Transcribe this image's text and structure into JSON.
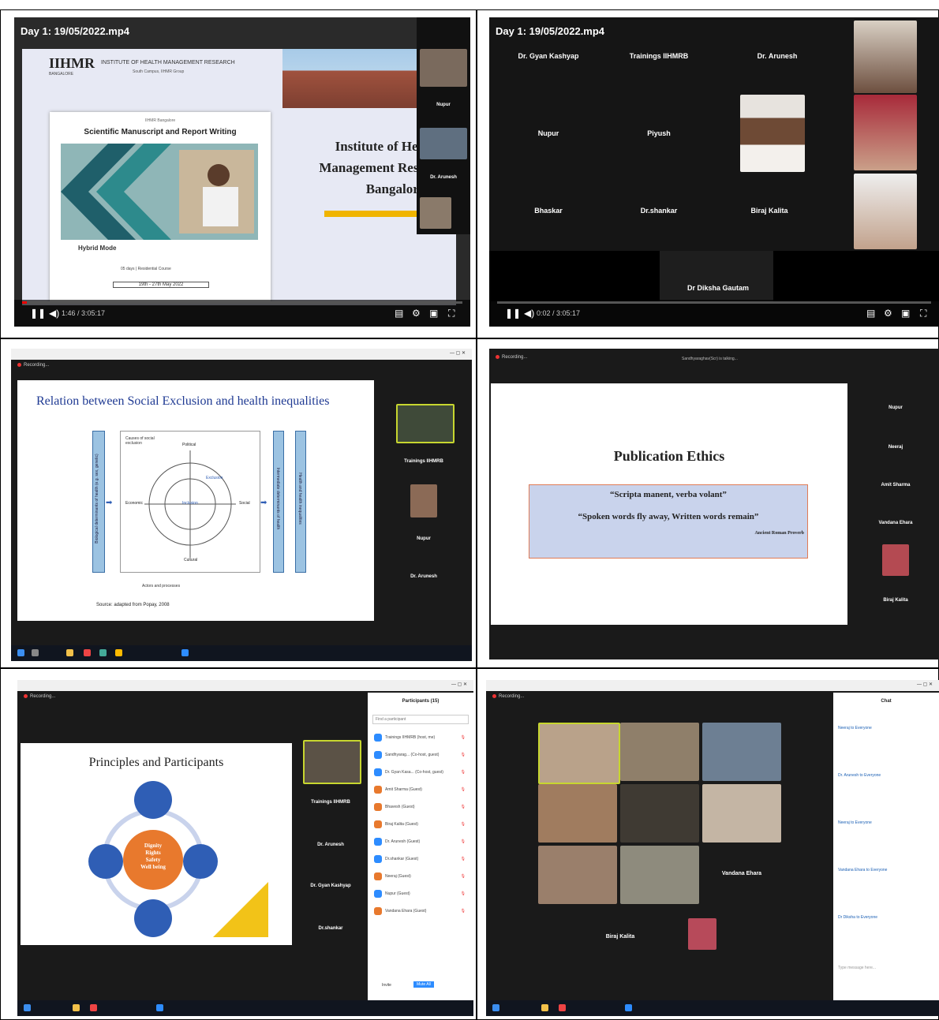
{
  "panels": {
    "p1": {
      "video_title": "Day 1: 19/05/2022.mp4",
      "logo_text": "IIHMR",
      "logo_subtext": "BANGALORE",
      "org_header": "INSTITUTE OF HEALTH MANAGEMENT RESEARCH",
      "org_sub": "South Campus, IIHMR Group",
      "poster_kicker": "IIHMR Bangalore",
      "poster_title": "Scientific Manuscript and Report Writing",
      "poster_mode": "Hybrid Mode",
      "poster_footer": "05 days | Residential Course",
      "poster_dates": "19th - 27th May 2022",
      "campus_line1": "Institute of Hea",
      "campus_line2": "Management Rese",
      "campus_line3": "Bangalore",
      "timecode": "1:46 / 3:05:17",
      "progress": 0.01,
      "side_tiles": [
        "Nupur",
        "Dr. Arunesh"
      ]
    },
    "p2": {
      "video_title": "Day 1: 19/05/2022.mp4",
      "timecode": "0:02 / 3:05:17",
      "progress": 0.0,
      "tiles": [
        "Dr. Gyan Kashyap",
        "Trainings IIHMRB",
        "Dr. Arunesh",
        "Nupur",
        "Piyush",
        "Bhaskar",
        "Dr.shankar",
        "Biraj Kalita",
        "Dr Diksha Gautam"
      ]
    },
    "p3": {
      "recording": "Recording...",
      "slide_title": "Relation between Social Exclusion and health inequalities",
      "left_bar": "Biological determinants of health (e.g. sex, genetic)",
      "right_bar1": "Intermediate determinants of health",
      "right_bar2": "Health and health inequalities",
      "dim_top_left": "Causes of social exclusion",
      "dim_political": "Political",
      "dim_economic": "Economic",
      "dim_social": "Social",
      "dim_cultural": "Cultural",
      "center_label": "Inclusion",
      "ring_label": "Exclusion",
      "bottom_label": "Actors and processes",
      "source": "Source: adapted from Popay, 2008",
      "sidebar": [
        "Trainings IIHMRB",
        "Nupur",
        "Dr. Arunesh"
      ]
    },
    "p4": {
      "recording": "Recording...",
      "top_label": "Sandhyaraghav(Scr) is talking...",
      "slide_title": "Publication Ethics",
      "quote1": "“Scripta manent, verba volant”",
      "quote2": "“Spoken words fly away, Written words remain”",
      "quote_source": "Ancient Roman Proverb",
      "sidebar": [
        "Nupur",
        "Neeraj",
        "Amit Sharma",
        "Vandana Ehara",
        "Biraj Kalita"
      ]
    },
    "p5": {
      "recording": "Recording...",
      "slide_title": "Principles and Participants",
      "center_text": [
        "Dignity",
        "Rights",
        "Safety",
        "Well being"
      ],
      "sidebar": [
        "Trainings IIHMRB",
        "Dr. Arunesh",
        "Dr. Gyan Kashyap",
        "Dr.shankar"
      ],
      "participants_header": "Participants (15)",
      "search_placeholder": "Find a participant",
      "participants": [
        "Trainings IIHMRB (host, me)",
        "Sandhyarag... (Co-host, guest)",
        "Dr. Gyan Kasa... (Co-host, guest)",
        "Amit Sharma (Guest)",
        "Bhavesh (Guest)",
        "Biraj Kalita (Guest)",
        "Dr. Arunesh (Guest)",
        "Dr.shankar (Guest)",
        "Neeraj (Guest)",
        "Nupur (Guest)",
        "Vandana Ehara (Guest)"
      ],
      "invite_btn": "Invite",
      "mute_btn": "Mute All"
    },
    "p6": {
      "recording": "Recording...",
      "chat_header": "Chat",
      "chat_msgs": [
        "Neeraj to Everyone",
        "Dr. Arunesh to Everyone",
        "Neeraj to Everyone",
        "Vandana Ehara to Everyone",
        "Dr Diksha to Everyone"
      ],
      "tile_names": [
        "Vandana Ehara",
        "Biraj Kalita"
      ],
      "chat_placeholder": "Type message here..."
    }
  },
  "colors": {
    "zoom_dark": "#1b1b1b",
    "accent_blue": "#2f5eb5",
    "orange": "#e8792d",
    "teal": "#1f6f7a",
    "slide_blue": "#c9d3ec"
  }
}
